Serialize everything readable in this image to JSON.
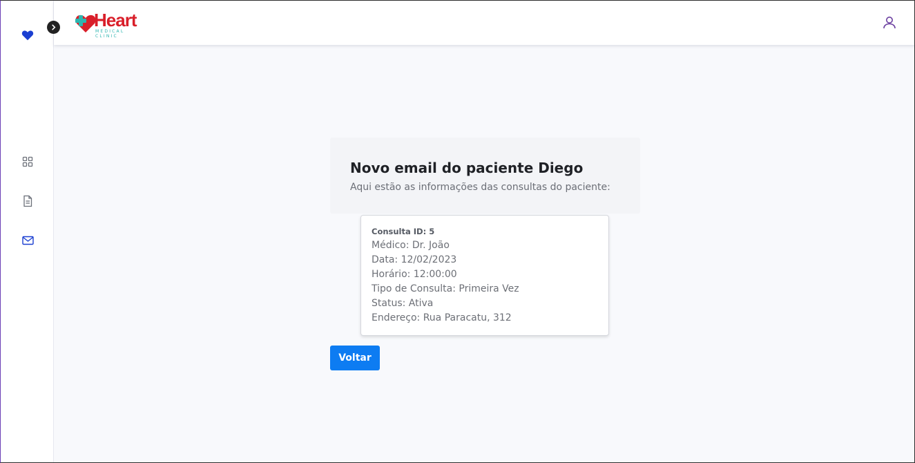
{
  "brand": {
    "name": "Heart",
    "tagline": "MEDICAL CLINIC",
    "primary_color": "#d91f2a",
    "secondary_color": "#2db5b0"
  },
  "sidebar": {
    "items": [
      {
        "icon": "heart-icon"
      },
      {
        "icon": "grid-icon"
      },
      {
        "icon": "document-icon"
      },
      {
        "icon": "mail-icon"
      }
    ]
  },
  "header": {
    "user_icon": "user-icon"
  },
  "main": {
    "title": "Novo email do paciente Diego",
    "subtitle": "Aqui estão as informações das consultas do paciente:",
    "consultation": {
      "id_label": "Consulta ID: 5",
      "medico": "Médico: Dr. João",
      "data": "Data: 12/02/2023",
      "horario": "Horário: 12:00:00",
      "tipo": "Tipo de Consulta: Primeira Vez",
      "status": "Status: Ativa",
      "endereco": "Endereço: Rua Paracatu, 312"
    },
    "back_button": "Voltar",
    "accent_color": "#0d7cf2"
  }
}
